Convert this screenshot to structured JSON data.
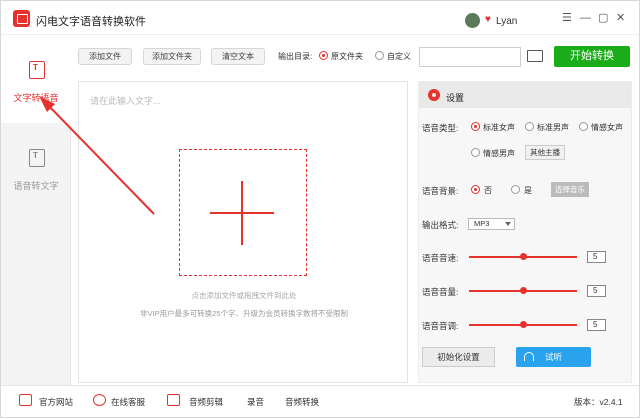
{
  "app": {
    "title": "闪电文字语音转换软件",
    "user": "Lyan"
  },
  "window_controls": [
    "☰",
    "—",
    "▢",
    "✕"
  ],
  "sidebar": {
    "items": [
      {
        "label": "文字转语音",
        "icon_text": "T",
        "active": true
      },
      {
        "label": "语音转文字",
        "icon_text": "T",
        "active": false
      }
    ]
  },
  "toolbar": {
    "add_file": "添加文件",
    "add_folder": "添加文件夹",
    "clear_text": "清空文本",
    "output_label": "输出目录:",
    "output_options": [
      "原文件夹",
      "自定义"
    ],
    "output_selected": "原文件夹",
    "path_value": "",
    "start_button": "开始转换"
  },
  "editor": {
    "placeholder": "请在此输入文字...",
    "hint_drag": "点击添加文件或拖拽文件到此处",
    "hint_limit": "非VIP用户最多可转换25个字、升级为会员转换字数将不受限制"
  },
  "settings": {
    "title": "设置",
    "voice_type_label": "语音类型:",
    "voice_types": [
      "标准女声",
      "标准男声",
      "情感女声",
      "情感男声"
    ],
    "voice_selected": "标准女声",
    "other_anchor": "其他主播",
    "bg_label": "语音背景:",
    "bg_options": [
      "否",
      "是"
    ],
    "bg_selected": "否",
    "choose_music": "选择音乐",
    "format_label": "输出格式:",
    "format_value": "MP3",
    "speed_label": "语音音速:",
    "speed_value": "5",
    "volume_label": "语音音量:",
    "volume_value": "5",
    "pitch_label": "语音音调:",
    "pitch_value": "5",
    "slider_level": 0.5,
    "reset": "初始化设置",
    "listen": "试听"
  },
  "footer": {
    "items": [
      "官方网站",
      "在线客服",
      "音频剪辑",
      "录音",
      "音频转换"
    ],
    "version": "版本：v2.4.1"
  },
  "colors": {
    "accent": "#e5322d",
    "start": "#1aad19",
    "listen": "#2aa3ee"
  }
}
